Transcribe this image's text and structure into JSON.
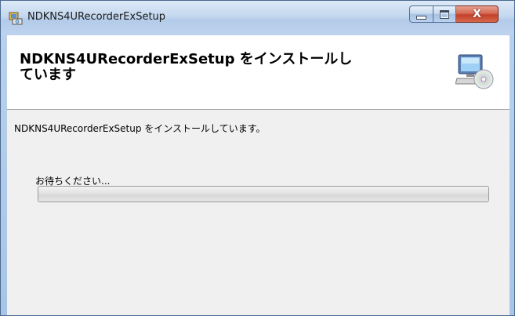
{
  "window": {
    "title": "NDKNS4URecorderExSetup",
    "app_icon": "installer-icon"
  },
  "caption_buttons": {
    "minimize_icon": "minimize-icon",
    "maximize_icon": "maximize-icon",
    "close_icon": "close-icon",
    "close_glyph": "X"
  },
  "banner": {
    "title": "NDKNS4URecorderExSetup をインストールしています",
    "icon": "computer-disc-icon"
  },
  "body": {
    "status_text": "NDKNS4URecorderExSetup をインストールしています。",
    "wait_label": "お待ちください..."
  },
  "progress": {
    "value": 0
  },
  "colors": {
    "progress_fill": "#3fb52c",
    "close_button": "#c2412b",
    "titlebar": "#c4d8ef"
  }
}
